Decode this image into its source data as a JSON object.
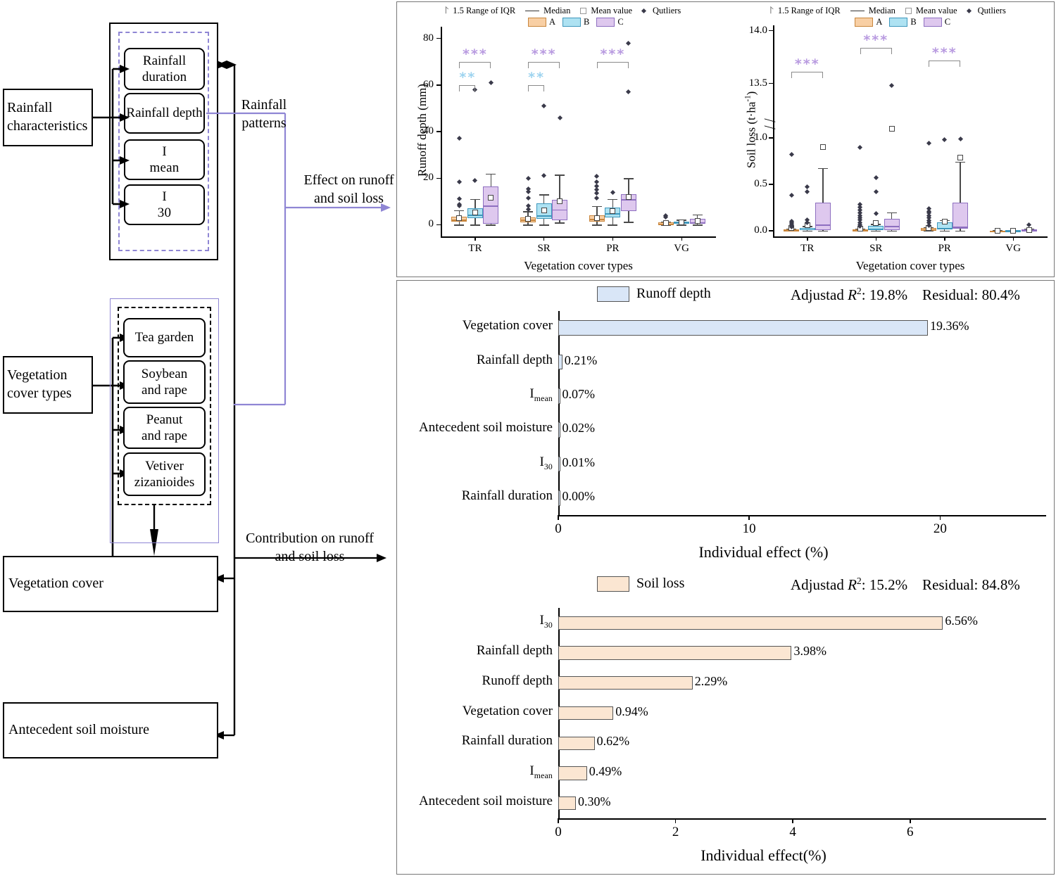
{
  "diagram": {
    "left_nodes": [
      {
        "label": "Rainfall\ncharacteristics"
      },
      {
        "label": "Vegetation\ncover types"
      },
      {
        "label": "Vegetation cover"
      },
      {
        "label": "Antecedent soil moisture"
      }
    ],
    "rainfall_items": [
      "Rainfall duration",
      "Rainfall depth",
      "Imean",
      "I30"
    ],
    "vegetation_items": [
      "Tea garden",
      "Soybean and rape",
      "Peanut and rape",
      "Vetiver zizanioides"
    ],
    "edge_labels": {
      "rainfall_patterns": "Rainfall\npatterns",
      "effect": "Effect on runoff\nand soil loss",
      "contribution": "Contribution on runoff\nand soil loss"
    }
  },
  "boxplot_legend": {
    "iqr": "1.5 Range of IQR",
    "median": "Median",
    "mean": "Mean value",
    "outliers": "Qutliers",
    "groups": [
      "A",
      "B",
      "C"
    ]
  },
  "colors": {
    "A": "#F8CFA4",
    "B": "#AEE2F2",
    "C": "#DEC8EE",
    "A_edge": "#C8863D",
    "B_edge": "#3E97BC",
    "C_edge": "#8E6FC0",
    "runoff_bar": "#D9E6F7",
    "soilloss_bar": "#FBE6D2",
    "accent_purple": "#8f86d4",
    "sig_purple": "#B89AE0",
    "sig_blue": "#9DD3EF"
  },
  "chart_data": [
    {
      "type": "box",
      "id": "runoff-depth-boxplot",
      "title": "",
      "ylabel": "Runoff depth (mm)",
      "xlabel": "Vegetation cover types",
      "categories": [
        "TR",
        "SR",
        "PR",
        "VG"
      ],
      "series": [
        "A",
        "B",
        "C"
      ],
      "ylim": [
        -5,
        85
      ],
      "yticks": [
        0,
        20,
        40,
        60,
        80
      ],
      "boxes": [
        {
          "cat": "TR",
          "grp": "A",
          "q1": 1.2,
          "median": 2.2,
          "q3": 3.4,
          "whisk_lo": 0.0,
          "whisk_hi": 6.2,
          "mean": 2.9,
          "outliers": [
            8.0,
            8.8,
            11.3,
            18.5,
            37.0
          ]
        },
        {
          "cat": "TR",
          "grp": "B",
          "q1": 3.0,
          "median": 4.4,
          "q3": 7.0,
          "whisk_lo": 0.0,
          "whisk_hi": 11.0,
          "mean": 5.4,
          "outliers": [
            19.0,
            58.0
          ]
        },
        {
          "cat": "TR",
          "grp": "C",
          "q1": 0.5,
          "median": 8.2,
          "q3": 16.5,
          "whisk_lo": 0.0,
          "whisk_hi": 22.0,
          "mean": 11.5,
          "outliers": [
            61.0
          ]
        },
        {
          "cat": "SR",
          "grp": "A",
          "q1": 0.9,
          "median": 2.1,
          "q3": 3.3,
          "whisk_lo": 0.0,
          "whisk_hi": 5.8,
          "mean": 2.6,
          "outliers": [
            6.5,
            8.2,
            11.5,
            14.2,
            15.5,
            19.8
          ]
        },
        {
          "cat": "SR",
          "grp": "B",
          "q1": 2.6,
          "median": 4.0,
          "q3": 9.1,
          "whisk_lo": 0.0,
          "whisk_hi": 13.0,
          "mean": 6.2,
          "outliers": [
            21.0,
            51.0
          ]
        },
        {
          "cat": "SR",
          "grp": "C",
          "q1": 2.0,
          "median": 6.6,
          "q3": 10.8,
          "whisk_lo": 1.0,
          "whisk_hi": 21.5,
          "mean": 10.2,
          "outliers": [
            46.0
          ]
        },
        {
          "cat": "PR",
          "grp": "A",
          "q1": 1.3,
          "median": 2.4,
          "q3": 4.2,
          "whisk_lo": 0.0,
          "whisk_hi": 8.0,
          "mean": 3.0,
          "outliers": [
            11.5,
            13.5,
            15.0,
            16.5,
            18.3,
            20.8
          ]
        },
        {
          "cat": "PR",
          "grp": "B",
          "q1": 3.2,
          "median": 5.0,
          "q3": 7.5,
          "whisk_lo": 0.0,
          "whisk_hi": 11.0,
          "mean": 5.9,
          "outliers": [
            14.0
          ]
        },
        {
          "cat": "PR",
          "grp": "C",
          "q1": 6.0,
          "median": 11.0,
          "q3": 13.0,
          "whisk_lo": 1.2,
          "whisk_hi": 20.0,
          "mean": 11.8,
          "outliers": [
            57.0,
            78.0
          ]
        },
        {
          "cat": "VG",
          "grp": "A",
          "q1": 0.2,
          "median": 0.5,
          "q3": 0.9,
          "whisk_lo": 0.0,
          "whisk_hi": 1.4,
          "mean": 0.6,
          "outliers": [
            3.2,
            3.8
          ]
        },
        {
          "cat": "VG",
          "grp": "B",
          "q1": 0.4,
          "median": 0.9,
          "q3": 1.4,
          "whisk_lo": 0.0,
          "whisk_hi": 2.1,
          "mean": 1.0,
          "outliers": []
        },
        {
          "cat": "VG",
          "grp": "C",
          "q1": 0.4,
          "median": 1.1,
          "q3": 2.6,
          "whisk_lo": 0.0,
          "whisk_hi": 4.4,
          "mean": 1.6,
          "outliers": []
        }
      ],
      "significance": [
        {
          "cat": "TR",
          "from": "A",
          "to": "C",
          "stars": "***",
          "color": "purple",
          "level": 1
        },
        {
          "cat": "TR",
          "from": "A",
          "to": "B",
          "stars": "**",
          "color": "blue",
          "level": 0
        },
        {
          "cat": "SR",
          "from": "A",
          "to": "C",
          "stars": "***",
          "color": "purple",
          "level": 1
        },
        {
          "cat": "SR",
          "from": "A",
          "to": "B",
          "stars": "**",
          "color": "blue",
          "level": 0
        },
        {
          "cat": "PR",
          "from": "A",
          "to": "C",
          "stars": "***",
          "color": "purple",
          "level": 1
        }
      ]
    },
    {
      "type": "box",
      "id": "soil-loss-boxplot",
      "title": "",
      "ylabel": "Soil loss (t·ha-1)",
      "xlabel": "Vegetation cover types",
      "categories": [
        "TR",
        "SR",
        "PR",
        "VG"
      ],
      "series": [
        "A",
        "B",
        "C"
      ],
      "yticks_lower": [
        0.0,
        0.5,
        1.0
      ],
      "yticks_upper": [
        13.5,
        14.0
      ],
      "axis_break": true,
      "boxes": [
        {
          "cat": "TR",
          "grp": "A",
          "q1": 0.0,
          "median": 0.005,
          "q3": 0.012,
          "whisk_lo": 0.0,
          "whisk_hi": 0.02,
          "mean": 0.03,
          "outliers": [
            0.04,
            0.055,
            0.07,
            0.085,
            0.1,
            0.385,
            0.82
          ]
        },
        {
          "cat": "TR",
          "grp": "B",
          "q1": 0.005,
          "median": 0.018,
          "q3": 0.032,
          "whisk_lo": 0.0,
          "whisk_hi": 0.05,
          "mean": 0.06,
          "outliers": [
            0.09,
            0.115,
            0.42,
            0.47
          ]
        },
        {
          "cat": "TR",
          "grp": "C",
          "q1": 0.005,
          "median": 0.065,
          "q3": 0.3,
          "whisk_lo": 0.0,
          "whisk_hi": 0.675,
          "mean": 0.9,
          "outliers": []
        },
        {
          "cat": "SR",
          "grp": "A",
          "q1": 0.0,
          "median": 0.005,
          "q3": 0.015,
          "whisk_lo": 0.0,
          "whisk_hi": 0.025,
          "mean": 0.02,
          "outliers": [
            0.05,
            0.065,
            0.09,
            0.115,
            0.14,
            0.165,
            0.19,
            0.225,
            0.255,
            0.285,
            0.9
          ]
        },
        {
          "cat": "SR",
          "grp": "B",
          "q1": 0.008,
          "median": 0.022,
          "q3": 0.05,
          "whisk_lo": 0.0,
          "whisk_hi": 0.075,
          "mean": 0.085,
          "outliers": [
            0.185,
            0.42,
            0.57
          ]
        },
        {
          "cat": "SR",
          "grp": "C",
          "q1": 0.01,
          "median": 0.055,
          "q3": 0.13,
          "whisk_lo": 0.0,
          "whisk_hi": 0.2,
          "mean": 1.1,
          "outliers": [
            13.48
          ]
        },
        {
          "cat": "PR",
          "grp": "A",
          "q1": 0.003,
          "median": 0.012,
          "q3": 0.028,
          "whisk_lo": 0.0,
          "whisk_hi": 0.04,
          "mean": 0.03,
          "outliers": [
            0.06,
            0.085,
            0.11,
            0.14,
            0.165,
            0.19,
            0.21,
            0.235,
            0.94
          ]
        },
        {
          "cat": "PR",
          "grp": "B",
          "q1": 0.012,
          "median": 0.03,
          "q3": 0.095,
          "whisk_lo": 0.0,
          "whisk_hi": 0.115,
          "mean": 0.1,
          "outliers": [
            0.98
          ]
        },
        {
          "cat": "PR",
          "grp": "C",
          "q1": 0.02,
          "median": 0.045,
          "q3": 0.305,
          "whisk_lo": 0.0,
          "whisk_hi": 0.745,
          "mean": 0.785,
          "outliers": [
            0.99
          ]
        },
        {
          "cat": "VG",
          "grp": "A",
          "q1": 0.0,
          "median": 0.002,
          "q3": 0.004,
          "whisk_lo": 0.0,
          "whisk_hi": 0.006,
          "mean": 0.003,
          "outliers": []
        },
        {
          "cat": "VG",
          "grp": "B",
          "q1": 0.0,
          "median": 0.002,
          "q3": 0.005,
          "whisk_lo": 0.0,
          "whisk_hi": 0.008,
          "mean": 0.004,
          "outliers": []
        },
        {
          "cat": "VG",
          "grp": "C",
          "q1": 0.0,
          "median": 0.004,
          "q3": 0.012,
          "whisk_lo": 0.0,
          "whisk_hi": 0.02,
          "mean": 0.01,
          "outliers": [
            0.065
          ]
        }
      ],
      "significance": [
        {
          "cat": "TR",
          "from": "A",
          "to": "C",
          "stars": "***",
          "color": "purple",
          "level": 0
        },
        {
          "cat": "SR",
          "from": "A",
          "to": "C",
          "stars": "***",
          "color": "purple",
          "level": 2
        },
        {
          "cat": "PR",
          "from": "A",
          "to": "C",
          "stars": "***",
          "color": "purple",
          "level": 1
        }
      ]
    },
    {
      "type": "bar",
      "id": "runoff-depth-effects",
      "orientation": "horizontal",
      "legend": "Runoff depth",
      "stat_adjusted_label": "Adjustad",
      "stat_adjusted_value": "19.8%",
      "stat_residual_label": "Residual:",
      "stat_residual_value": "80.4%",
      "xlabel": "Individual effect (%)",
      "ylabel": "",
      "categories": [
        "Vegetation cover",
        "Rainfall depth",
        "Imean",
        "Antecedent soil moisture",
        "I30",
        "Rainfall duration"
      ],
      "values": [
        19.36,
        0.21,
        0.07,
        0.02,
        0.01,
        0.0
      ],
      "value_labels": [
        "19.36%",
        "0.21%",
        "0.07%",
        "0.02%",
        "0.01%",
        "0.00%"
      ],
      "xticks": [
        0,
        10,
        20
      ],
      "xlim": [
        0,
        21.5
      ]
    },
    {
      "type": "bar",
      "id": "soil-loss-effects",
      "orientation": "horizontal",
      "legend": "Soil loss",
      "stat_adjusted_label": "Adjustad",
      "stat_adjusted_value": "15.2%",
      "stat_residual_label": "Residual:",
      "stat_residual_value": "84.8%",
      "xlabel": "Individual effect(%)",
      "ylabel": "",
      "categories": [
        "I30",
        "Rainfall depth",
        "Runoff depth",
        "Vegetation cover",
        "Rainfall duration",
        "Imean",
        "Antecedent soil moisture"
      ],
      "values": [
        6.56,
        3.98,
        2.29,
        0.94,
        0.62,
        0.49,
        0.3
      ],
      "value_labels": [
        "6.56%",
        "3.98%",
        "2.29%",
        "0.94%",
        "0.62%",
        "0.49%",
        "0.30%"
      ],
      "xticks": [
        0,
        2,
        4,
        6
      ],
      "xlim": [
        0,
        7.0
      ]
    }
  ]
}
